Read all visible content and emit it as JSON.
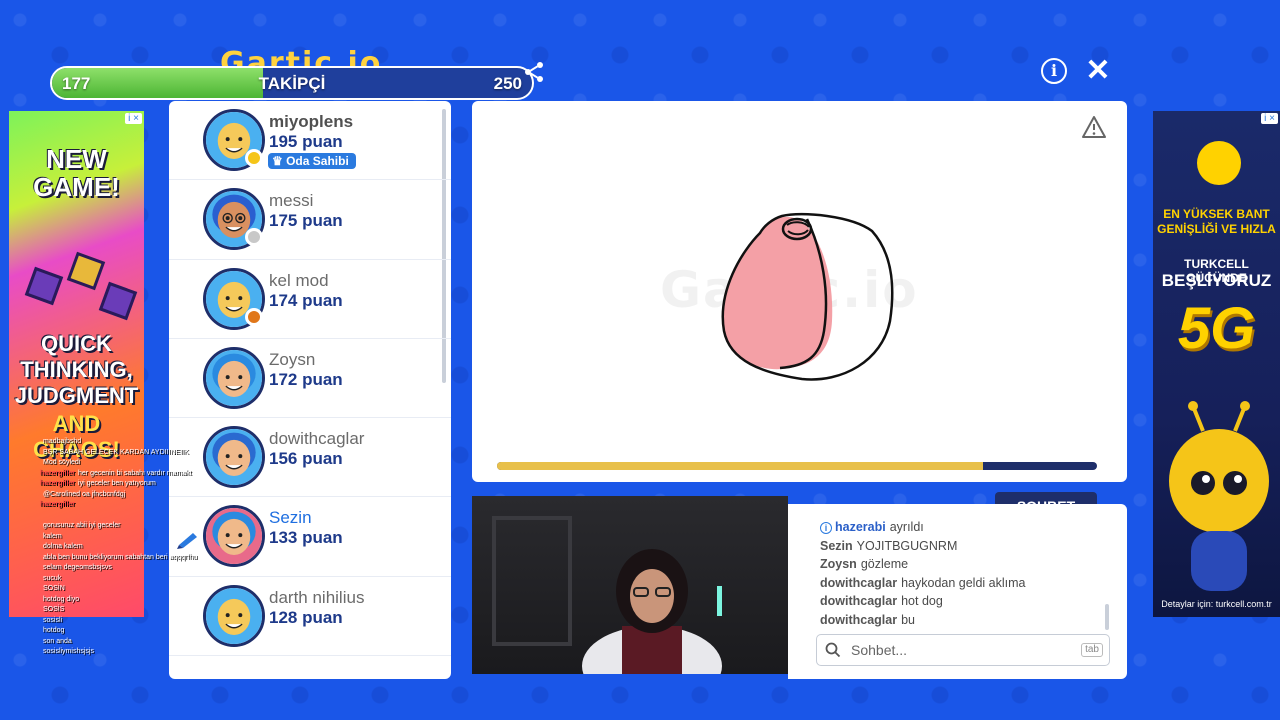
{
  "follower_bar": {
    "min": "177",
    "label": "TAKİPÇİ",
    "max": "250",
    "progress": 0.44
  },
  "logo_text": "Gartic.io",
  "top_icons": {
    "info": "info-icon",
    "close": "close-icon",
    "share": "share-icon",
    "mute": "speaker-icon"
  },
  "ad_left": {
    "badge": "i ×",
    "line1": "NEW GAME!",
    "line2": "QUICK THINKING, JUDGMENT",
    "line3": "AND CHAOS!"
  },
  "ad_right": {
    "badge": "i ×",
    "line1": "EN YÜKSEK BANT GENİŞLİĞİ VE HIZLA",
    "line2": "TURKCELL GÜCÜNDE",
    "line3": "BEŞLİYORUZ",
    "line4": "5G",
    "footer": "Detaylar için: turkcell.com.tr"
  },
  "players": [
    {
      "name": "miyoplens",
      "score": "195 puan",
      "tag": "Oda Sahibi",
      "status_color": "#f5c518",
      "bold": true
    },
    {
      "name": "messi",
      "score": "175 puan",
      "status_color": "#c8c8c8",
      "bold": false
    },
    {
      "name": "kel mod",
      "score": "174 puan",
      "status_color": "#e0771a",
      "bold": false
    },
    {
      "name": "Zoysn",
      "score": "172 puan",
      "bold": false
    },
    {
      "name": "dowithcaglar",
      "score": "156 puan",
      "bold": false
    },
    {
      "name": "Sezin",
      "score": "133 puan",
      "bold": false,
      "drawing": true
    },
    {
      "name": "darth nihilius",
      "score": "128 puan",
      "bold": false
    }
  ],
  "canvas": {
    "watermark": "Gartic.io",
    "timer_progress": 0.81
  },
  "chat": {
    "tab_label": "SOHBET",
    "lines": [
      {
        "who": "hazerabi",
        "text": "ayrıldı",
        "system": true
      },
      {
        "who": "Sezin",
        "text": "YOJITBGUGNRM"
      },
      {
        "who": "Zoysn",
        "text": "gözleme"
      },
      {
        "who": "dowithcaglar",
        "text": "haykodan geldi aklıma"
      },
      {
        "who": "dowithcaglar",
        "text": "hot dog"
      },
      {
        "who": "dowithcaglar",
        "text": "bu"
      }
    ],
    "input_placeholder": "Sohbet...",
    "tab_hint": "tab"
  },
  "stream_chat": [
    {
      "u": "",
      "m": "madbajbshd"
    },
    {
      "u": "",
      "m": "BŞR SABAH GELECEK KARDAN AYDIIINEIIK"
    },
    {
      "u": "",
      "m": "Mod söyledi"
    },
    {
      "u": "hazergiller",
      "m": "her gecenin bi sabahı vardır mamakt"
    },
    {
      "u": "hazergiller",
      "m": "iyi geceler ben yatıyorum"
    },
    {
      "u": "",
      "m": "@Carolined oa jfncbcnfdgj"
    },
    {
      "u": "hazergiller",
      "m": ""
    },
    {
      "u": "",
      "m": ""
    },
    {
      "u": "",
      "m": "gorusuruz abii iyi geceler"
    },
    {
      "u": "",
      "m": "kalem"
    },
    {
      "u": "",
      "m": "dolma kalem"
    },
    {
      "u": "",
      "m": "abla ben bunu bekliyorum sabahtan beri aqqqrfhu"
    },
    {
      "u": "",
      "m": "selam degeomsbsjsvs"
    },
    {
      "u": "",
      "m": "sucuk"
    },
    {
      "u": "",
      "m": "SOSİN"
    },
    {
      "u": "",
      "m": "hotdog diyo"
    },
    {
      "u": "",
      "m": "SOSİS"
    },
    {
      "u": "",
      "m": "sosisli"
    },
    {
      "u": "",
      "m": "hotdog"
    },
    {
      "u": "",
      "m": "son anda"
    },
    {
      "u": "",
      "m": "sosisliymishsjsjs"
    }
  ]
}
